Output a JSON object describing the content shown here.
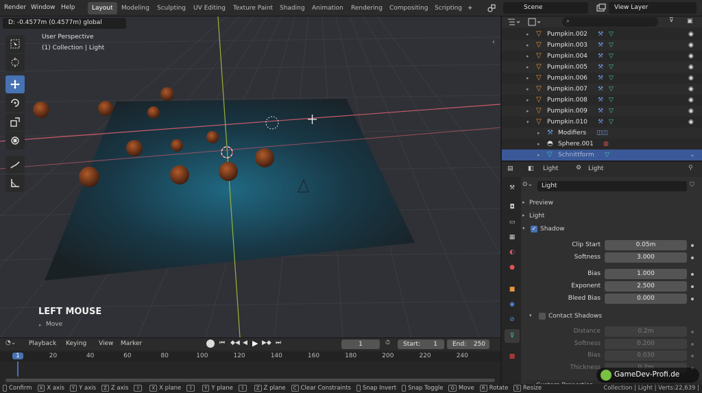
{
  "menus": [
    "Render",
    "Window",
    "Help"
  ],
  "workspaces": [
    "Layout",
    "Modeling",
    "Sculpting",
    "UV Editing",
    "Texture Paint",
    "Shading",
    "Animation",
    "Rendering",
    "Compositing",
    "Scripting"
  ],
  "add_tab_label": "+",
  "scene_name": "Scene",
  "view_layer": "View Layer",
  "viewport": {
    "header_readout": "D: -0.4577m (0.4577m) global",
    "perspective": "User Perspective",
    "collection_info": "(1) Collection | Light",
    "operator_title": "LEFT MOUSE",
    "operator_sub": "Move"
  },
  "outliner": {
    "items": [
      {
        "name": "Pumpkin.002",
        "kind": "object"
      },
      {
        "name": "Pumpkin.003",
        "kind": "object"
      },
      {
        "name": "Pumpkin.004",
        "kind": "object"
      },
      {
        "name": "Pumpkin.005",
        "kind": "object"
      },
      {
        "name": "Pumpkin.006",
        "kind": "object"
      },
      {
        "name": "Pumpkin.007",
        "kind": "object"
      },
      {
        "name": "Pumpkin.008",
        "kind": "object"
      },
      {
        "name": "Pumpkin.009",
        "kind": "object"
      },
      {
        "name": "Pumpkin.010",
        "kind": "object"
      },
      {
        "name": "Modifiers",
        "kind": "modifiers"
      },
      {
        "name": "Sphere.001",
        "kind": "material"
      },
      {
        "name": "Schnittform",
        "kind": "mesh"
      }
    ]
  },
  "properties": {
    "header_left": "Light",
    "header_right": "Light",
    "datablock": "Light",
    "panels": {
      "preview": "Preview",
      "light": "Light",
      "shadow": "Shadow",
      "contact": "Contact Shadows"
    },
    "shadow": [
      {
        "label": "Clip Start",
        "value": "0.05m"
      },
      {
        "label": "Softness",
        "value": "3.000"
      },
      {
        "label": "Bias",
        "value": "1.000"
      },
      {
        "label": "Exponent",
        "value": "2.500"
      },
      {
        "label": "Bleed Bias",
        "value": "0.000"
      }
    ],
    "contact": [
      {
        "label": "Distance",
        "value": "0.2m"
      },
      {
        "label": "Softness",
        "value": "0.200"
      },
      {
        "label": "Bias",
        "value": "0.030"
      },
      {
        "label": "Thickness",
        "value": "0.2m"
      }
    ],
    "truncated_panel": "Custom Properties"
  },
  "timeline": {
    "menus": [
      "Playback",
      "Keying",
      "View",
      "Marker"
    ],
    "current_frame": "1",
    "start_label": "Start:",
    "start": "1",
    "end_label": "End:",
    "end": "250",
    "ruler": [
      "1",
      "20",
      "40",
      "60",
      "80",
      "100",
      "120",
      "140",
      "160",
      "180",
      "200",
      "220",
      "240"
    ]
  },
  "status": {
    "items": [
      {
        "key": "",
        "label": "Confirm"
      },
      {
        "key": "X",
        "label": "X axis"
      },
      {
        "key": "Y",
        "label": "Y axis"
      },
      {
        "key": "Z",
        "label": "Z axis"
      },
      {
        "key": "⇧",
        "label": ""
      },
      {
        "key": "X",
        "label": "X plane"
      },
      {
        "key": "⇧",
        "label": ""
      },
      {
        "key": "Y",
        "label": "Y plane"
      },
      {
        "key": "⇧",
        "label": ""
      },
      {
        "key": "Z",
        "label": "Z plane"
      },
      {
        "key": "C",
        "label": "Clear Constraints"
      },
      {
        "key": "",
        "label": "Snap Invert"
      },
      {
        "key": "",
        "label": "Snap Toggle"
      },
      {
        "key": "G",
        "label": "Move"
      },
      {
        "key": "R",
        "label": "Rotate"
      },
      {
        "key": "S",
        "label": "Resize"
      }
    ],
    "right": "Collection | Light | Verts:22,639 |"
  },
  "watermark": "GameDev-Profi.de",
  "colors": {
    "accent": "#4772b3",
    "object_orange": "#e8963c",
    "selection": "#3b5998"
  }
}
